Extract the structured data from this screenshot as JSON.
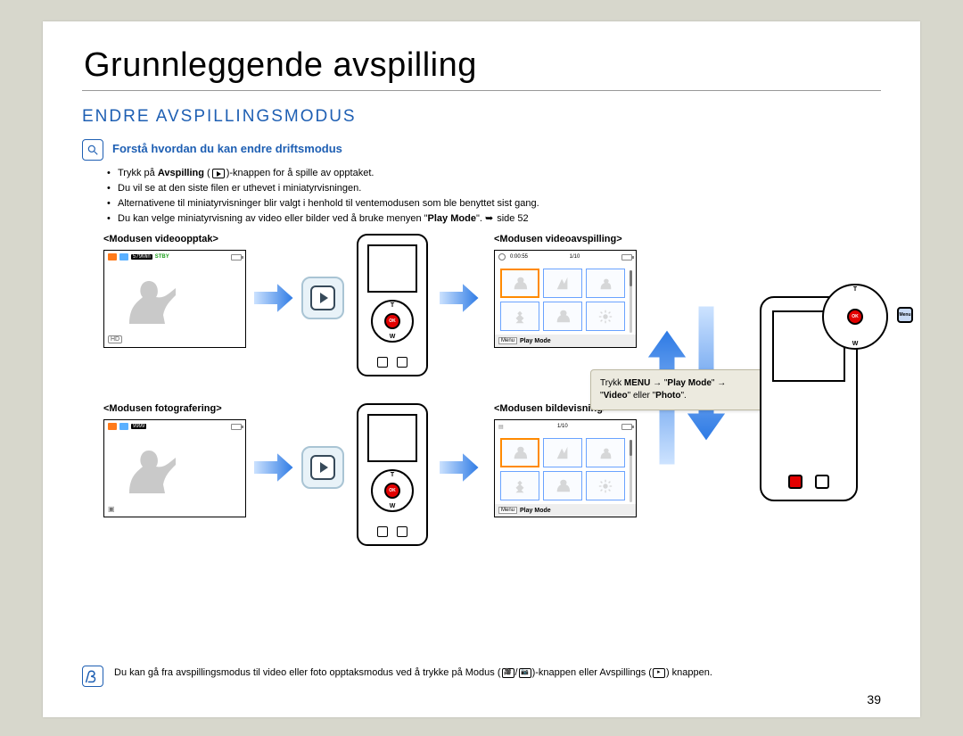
{
  "chapter_title": "Grunnleggende avspilling",
  "section_title": "ENDRE AVSPILLINGSMODUS",
  "tip": {
    "title": "Forstå hvordan du kan endre driftsmodus",
    "bullets": [
      {
        "pre": "Trykk på ",
        "bold1": "Avspilling",
        "mid": " (",
        "glyph": "play",
        "post": ")-knappen for å spille av opptaket."
      },
      {
        "text": "Du vil se at den siste filen er uthevet i miniatyrvisningen."
      },
      {
        "text": "Alternativene til miniatyrvisninger blir valgt i henhold til ventemodusen som ble benyttet sist gang."
      },
      {
        "pre": "Du kan velge miniatyrvisning av video eller bilder ved å bruke menyen \"",
        "bold1": "Play Mode",
        "post_quote": "\". ",
        "link": "side 52"
      }
    ]
  },
  "labels": {
    "video_rec": "<Modusen videoopptak>",
    "photo_rec": "<Modusen fotografering>",
    "video_play": "<Modusen videoavspilling>",
    "photo_play": "<Modusen bildevisning>"
  },
  "osd": {
    "rec_time_remaining": "579Min",
    "stby": "STBY",
    "hd": "HD",
    "photo_count": "9999",
    "clip_time": "0:00:55",
    "index": "1/10",
    "playmode_label": "Play Mode",
    "menu_chip": "Menu"
  },
  "callout": {
    "line1_pre": "Trykk ",
    "line1_bold": "MENU",
    "line1_mid": " → \"",
    "line1_bold2": "Play Mode",
    "line1_post": "\" → ",
    "line2_pre": "\"",
    "line2_bold": "Video",
    "line2_mid": "\" eller \"",
    "line2_bold2": "Photo",
    "line2_post": "\"."
  },
  "dpad": {
    "top": "T",
    "bottom": "W",
    "center": "OK",
    "menu": "Menu"
  },
  "footnote": {
    "pre": "Du kan gå fra avspillingsmodus til video eller foto opptaksmodus ved å trykke på ",
    "bold1": "Modus",
    "mid1": " (",
    "glyph1": "vid",
    "sep": "/",
    "glyph2": "cam",
    "mid2": ")-knappen eller ",
    "bold2": "Avspillings",
    "mid3": " (",
    "glyph3": "play",
    "post": ") knappen."
  },
  "page_number": "39"
}
